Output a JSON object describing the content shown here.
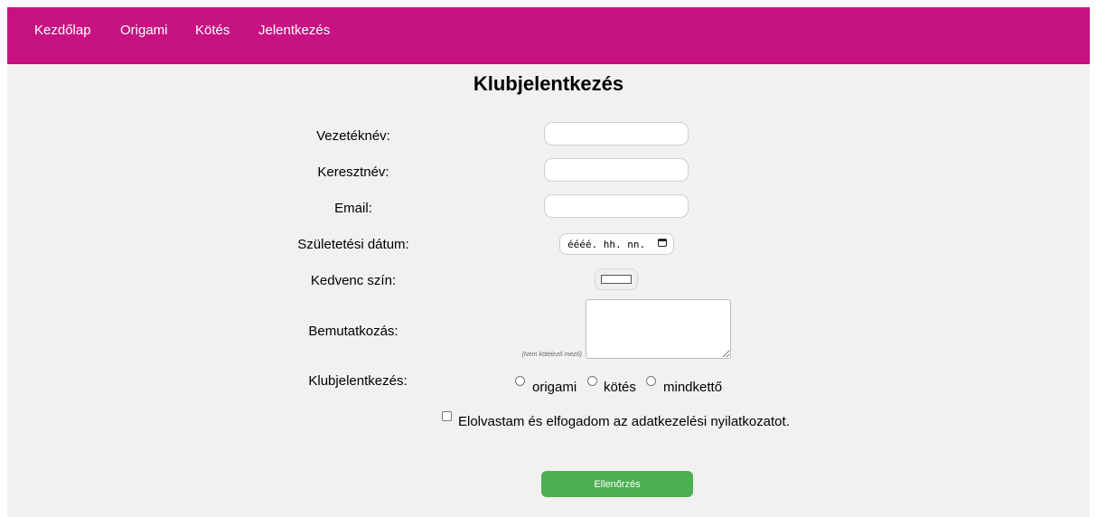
{
  "nav": {
    "items": [
      {
        "label": "Kezdőlap"
      },
      {
        "label": "Origami"
      },
      {
        "label": "Kötés"
      },
      {
        "label": "Jelentkezés"
      }
    ]
  },
  "page": {
    "title": "Klubjelentkezés"
  },
  "form": {
    "lastname_label": "Vezetéknév:",
    "lastname_value": "",
    "firstname_label": "Keresztnév:",
    "firstname_value": "",
    "email_label": "Email:",
    "email_value": "",
    "birthdate_label": "Születetési dátum:",
    "birthdate_placeholder": "éééé. hh. nn.",
    "color_label": "Kedvenc szín:",
    "color_value": "#ffffff",
    "intro_label": "Bemutatkozás:",
    "intro_hint": "(Nem kötelező mező)",
    "intro_value": "",
    "club_label": "Klubjelentkezés:",
    "club_options": [
      {
        "label": "origami",
        "checked": false
      },
      {
        "label": "kötés",
        "checked": false
      },
      {
        "label": "mindkettő",
        "checked": false
      }
    ],
    "consent_label": "Elolvastam és elfogadom az adatkezelési nyilatkozatot.",
    "consent_checked": false,
    "submit_label": "Ellenőrzés"
  },
  "colors": {
    "navbar": "#c71381",
    "background": "#f1f1f1",
    "submit": "#4caf50"
  },
  "icons": {
    "date_picker": "calendar-icon"
  }
}
